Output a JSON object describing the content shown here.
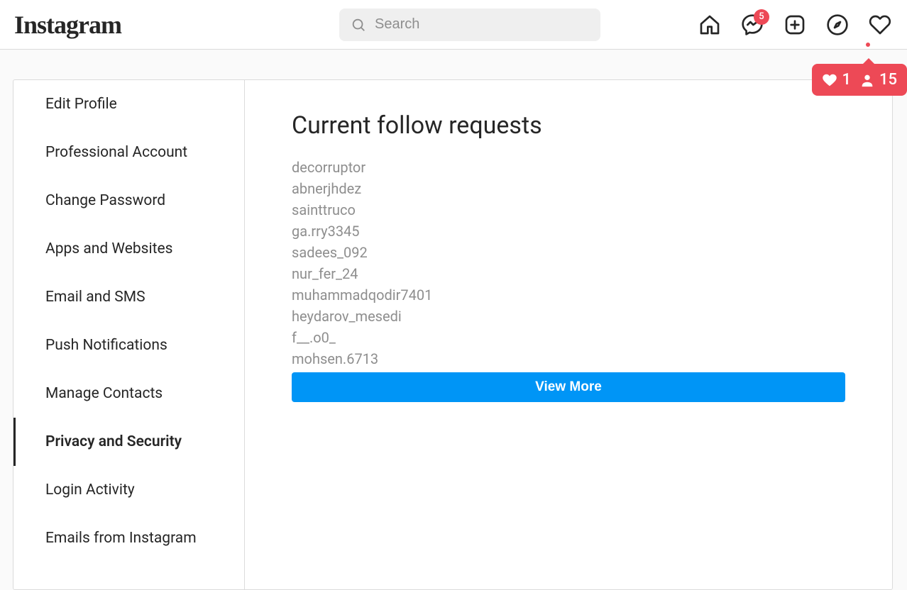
{
  "brand": "Instagram",
  "search": {
    "placeholder": "Search"
  },
  "nav": {
    "messenger_badge": "5"
  },
  "activity_popover": {
    "likes": "1",
    "follows": "15"
  },
  "sidebar": {
    "items": [
      {
        "label": "Edit Profile",
        "active": false
      },
      {
        "label": "Professional Account",
        "active": false
      },
      {
        "label": "Change Password",
        "active": false
      },
      {
        "label": "Apps and Websites",
        "active": false
      },
      {
        "label": "Email and SMS",
        "active": false
      },
      {
        "label": "Push Notifications",
        "active": false
      },
      {
        "label": "Manage Contacts",
        "active": false
      },
      {
        "label": "Privacy and Security",
        "active": true
      },
      {
        "label": "Login Activity",
        "active": false
      },
      {
        "label": "Emails from Instagram",
        "active": false
      }
    ]
  },
  "main": {
    "heading": "Current follow requests",
    "requests": [
      "decorruptor",
      "abnerjhdez",
      "sainttruco",
      "ga.rry3345",
      "sadees_092",
      "nur_fer_24",
      "muhammadqodir7401",
      "heydarov_mesedi",
      "f__.o0_",
      "mohsen.6713"
    ],
    "view_more": "View More"
  }
}
